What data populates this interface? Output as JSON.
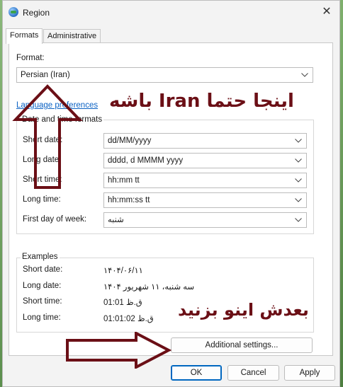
{
  "window": {
    "title": "Region",
    "close_glyph": "✕"
  },
  "tabs": [
    {
      "label": "Formats"
    },
    {
      "label": "Administrative"
    }
  ],
  "format": {
    "label": "Format:",
    "value": "Persian (Iran)"
  },
  "language_link": "Language preferences",
  "date_time": {
    "group_title": "Date and time formats",
    "short_date": {
      "label": "Short date:",
      "value": "dd/MM/yyyy"
    },
    "long_date": {
      "label": "Long date:",
      "value": "dddd, d MMMM yyyy"
    },
    "short_time": {
      "label": "Short time:",
      "value": "hh:mm tt"
    },
    "long_time": {
      "label": "Long time:",
      "value": "hh:mm:ss tt"
    },
    "first_day": {
      "label": "First day of week:",
      "value": "شنبه"
    }
  },
  "examples": {
    "group_title": "Examples",
    "short_date": {
      "label": "Short date:",
      "value": "۱۴۰۴/۰۶/۱۱"
    },
    "long_date": {
      "label": "Long date:",
      "value": "سه شنبه، ۱۱ شهریور ۱۴۰۴"
    },
    "short_time": {
      "label": "Short time:",
      "value": "ق.ظ 01:01"
    },
    "long_time": {
      "label": "Long time:",
      "value": "ق.ظ 01:01:02"
    }
  },
  "additional_settings": "Additional settings...",
  "buttons": {
    "ok": "OK",
    "cancel": "Cancel",
    "apply": "Apply"
  },
  "annotations": {
    "top": "اینجا حتما Iran باشه",
    "bottom": "بعدش اینو بزنید",
    "color": "#6b0f16"
  }
}
